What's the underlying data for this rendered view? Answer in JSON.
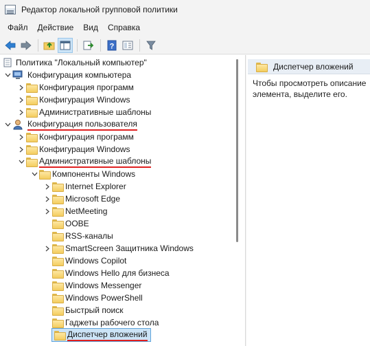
{
  "window": {
    "title": "Редактор локальной групповой политики"
  },
  "menu": {
    "items": [
      "Файл",
      "Действие",
      "Вид",
      "Справка"
    ]
  },
  "toolbar": {
    "buttons": [
      "back-arrow-icon",
      "forward-arrow-icon",
      "up-folder-icon",
      "show-hide-tree-icon",
      "export-list-icon",
      "help-icon",
      "properties-icon",
      "filter-icon"
    ]
  },
  "tree": {
    "root": "Политика \"Локальный компьютер\"",
    "computer_config": "Конфигурация компьютера",
    "cc_software": "Конфигурация программ",
    "cc_windows": "Конфигурация Windows",
    "cc_admin": "Административные шаблоны",
    "user_config": "Конфигурация пользователя",
    "uc_software": "Конфигурация программ",
    "uc_windows": "Конфигурация Windows",
    "uc_admin": "Административные шаблоны",
    "windows_components": "Компоненты Windows",
    "components": [
      "Internet Explorer",
      "Microsoft Edge",
      "NetMeeting",
      "OOBE",
      "RSS-каналы",
      "SmartScreen Защитника Windows",
      "Windows Copilot",
      "Windows Hello для бизнеса",
      "Windows Messenger",
      "Windows PowerShell",
      "Быстрый поиск",
      "Гаджеты рабочего стола",
      "Диспетчер вложений"
    ]
  },
  "details": {
    "title": "Диспетчер вложений",
    "description": "Чтобы просмотреть описание элемента, выделите его."
  }
}
